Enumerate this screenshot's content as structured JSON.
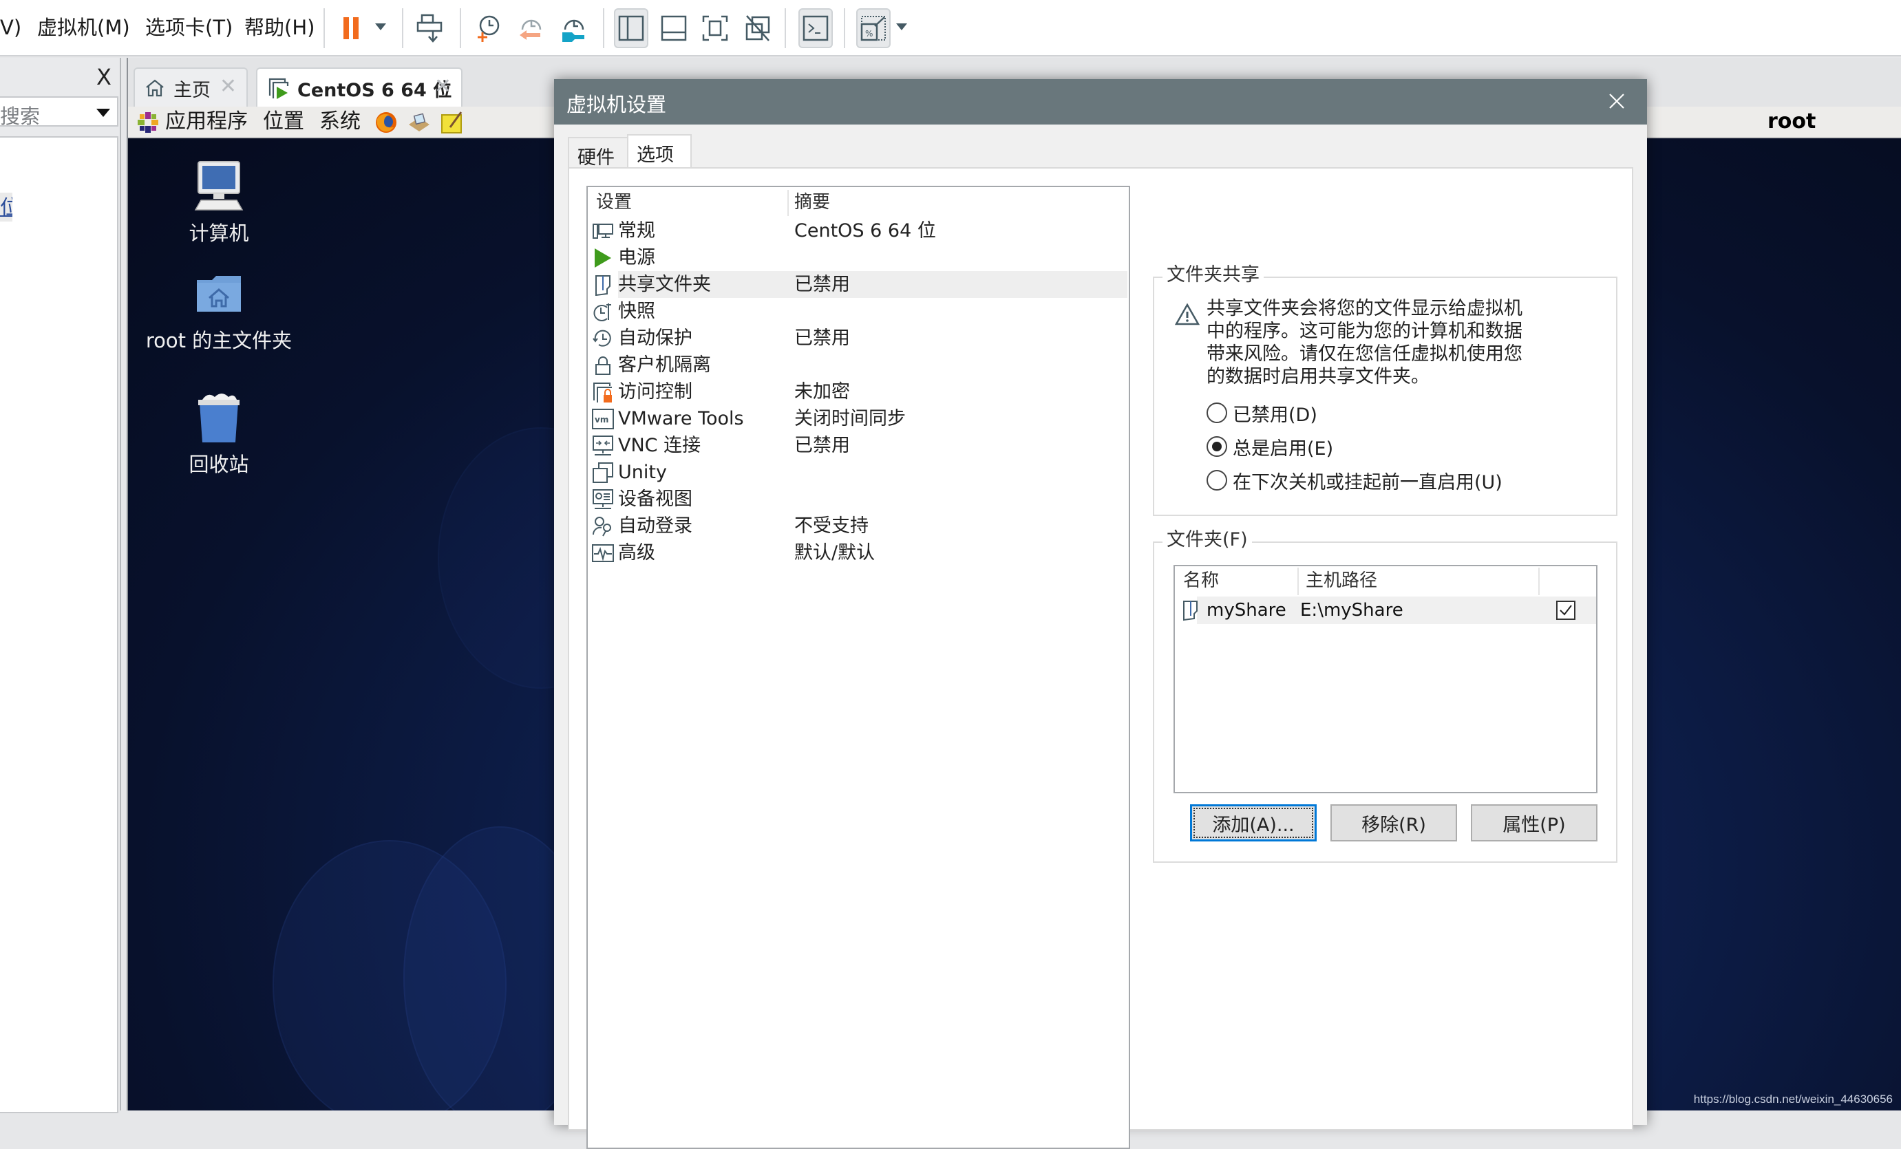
{
  "menubar": {
    "items": [
      {
        "label": "V)",
        "id": "view"
      },
      {
        "label": "虚拟机(M)",
        "id": "vm"
      },
      {
        "label": "选项卡(T)",
        "id": "tabs"
      },
      {
        "label": "帮助(H)",
        "id": "help"
      }
    ]
  },
  "toolbar": {
    "icons": [
      "pause-icon",
      "send-ctrl-alt-del-icon",
      "take-snapshot-icon",
      "revert-snapshot-icon",
      "snapshot-manager-icon",
      "show-library-icon",
      "show-thumbnail-bar-icon",
      "full-screen-icon",
      "unity-icon",
      "console-view-icon",
      "stretch-guest-icon"
    ]
  },
  "library": {
    "close_label": "X",
    "search_placeholder": "搜索",
    "tree_item_fragment": "位"
  },
  "vm_tabs": [
    {
      "label": "主页",
      "icon": "home-icon",
      "active": false
    },
    {
      "label": "CentOS 6 64 位",
      "icon": "vm-running-icon",
      "active": true
    }
  ],
  "guest": {
    "panel_menus": [
      "应用程序",
      "位置",
      "系统"
    ],
    "panel_user": "root",
    "desktop_icons": [
      {
        "label": "计算机",
        "icon": "computer-icon"
      },
      {
        "label": "root 的主文件夹",
        "icon": "home-folder-icon"
      },
      {
        "label": "回收站",
        "icon": "trash-icon"
      }
    ]
  },
  "dialog": {
    "title": "虚拟机设置",
    "tabs": [
      {
        "label": "硬件",
        "active": false
      },
      {
        "label": "选项",
        "active": true
      }
    ],
    "settings_list": {
      "columns": [
        "设置",
        "摘要"
      ],
      "rows": [
        {
          "name": "常规",
          "summary": "CentOS 6 64 位",
          "icon": "general-icon"
        },
        {
          "name": "电源",
          "summary": "",
          "icon": "power-icon"
        },
        {
          "name": "共享文件夹",
          "summary": "已禁用",
          "icon": "shared-folder-icon",
          "selected": true
        },
        {
          "name": "快照",
          "summary": "",
          "icon": "snapshot-icon"
        },
        {
          "name": "自动保护",
          "summary": "已禁用",
          "icon": "autoprotect-icon"
        },
        {
          "name": "客户机隔离",
          "summary": "",
          "icon": "lock-icon"
        },
        {
          "name": "访问控制",
          "summary": "未加密",
          "icon": "access-control-icon"
        },
        {
          "name": "VMware Tools",
          "summary": "关闭时间同步",
          "icon": "vmware-tools-icon"
        },
        {
          "name": "VNC 连接",
          "summary": "已禁用",
          "icon": "vnc-icon"
        },
        {
          "name": "Unity",
          "summary": "",
          "icon": "unity-icon"
        },
        {
          "name": "设备视图",
          "summary": "",
          "icon": "device-view-icon"
        },
        {
          "name": "自动登录",
          "summary": "不受支持",
          "icon": "autologin-icon"
        },
        {
          "name": "高级",
          "summary": "默认/默认",
          "icon": "advanced-icon"
        }
      ]
    },
    "folder_sharing": {
      "legend": "文件夹共享",
      "warning": "共享文件夹会将您的文件显示给虚拟机中的程序。这可能为您的计算机和数据带来风险。请仅在您信任虚拟机使用您的数据时启用共享文件夹。",
      "options": [
        {
          "label": "已禁用(D)",
          "checked": false
        },
        {
          "label": "总是启用(E)",
          "checked": true
        },
        {
          "label": "在下次关机或挂起前一直启用(U)",
          "checked": false
        }
      ]
    },
    "folders": {
      "legend": "文件夹(F)",
      "columns": [
        "名称",
        "主机路径",
        ""
      ],
      "rows": [
        {
          "name": "myShare",
          "host_path": "E:\\myShare",
          "enabled": true
        }
      ],
      "buttons": {
        "add": "添加(A)...",
        "remove": "移除(R)",
        "properties": "属性(P)"
      }
    }
  },
  "watermark": "https://blog.csdn.net/weixin_44630656"
}
